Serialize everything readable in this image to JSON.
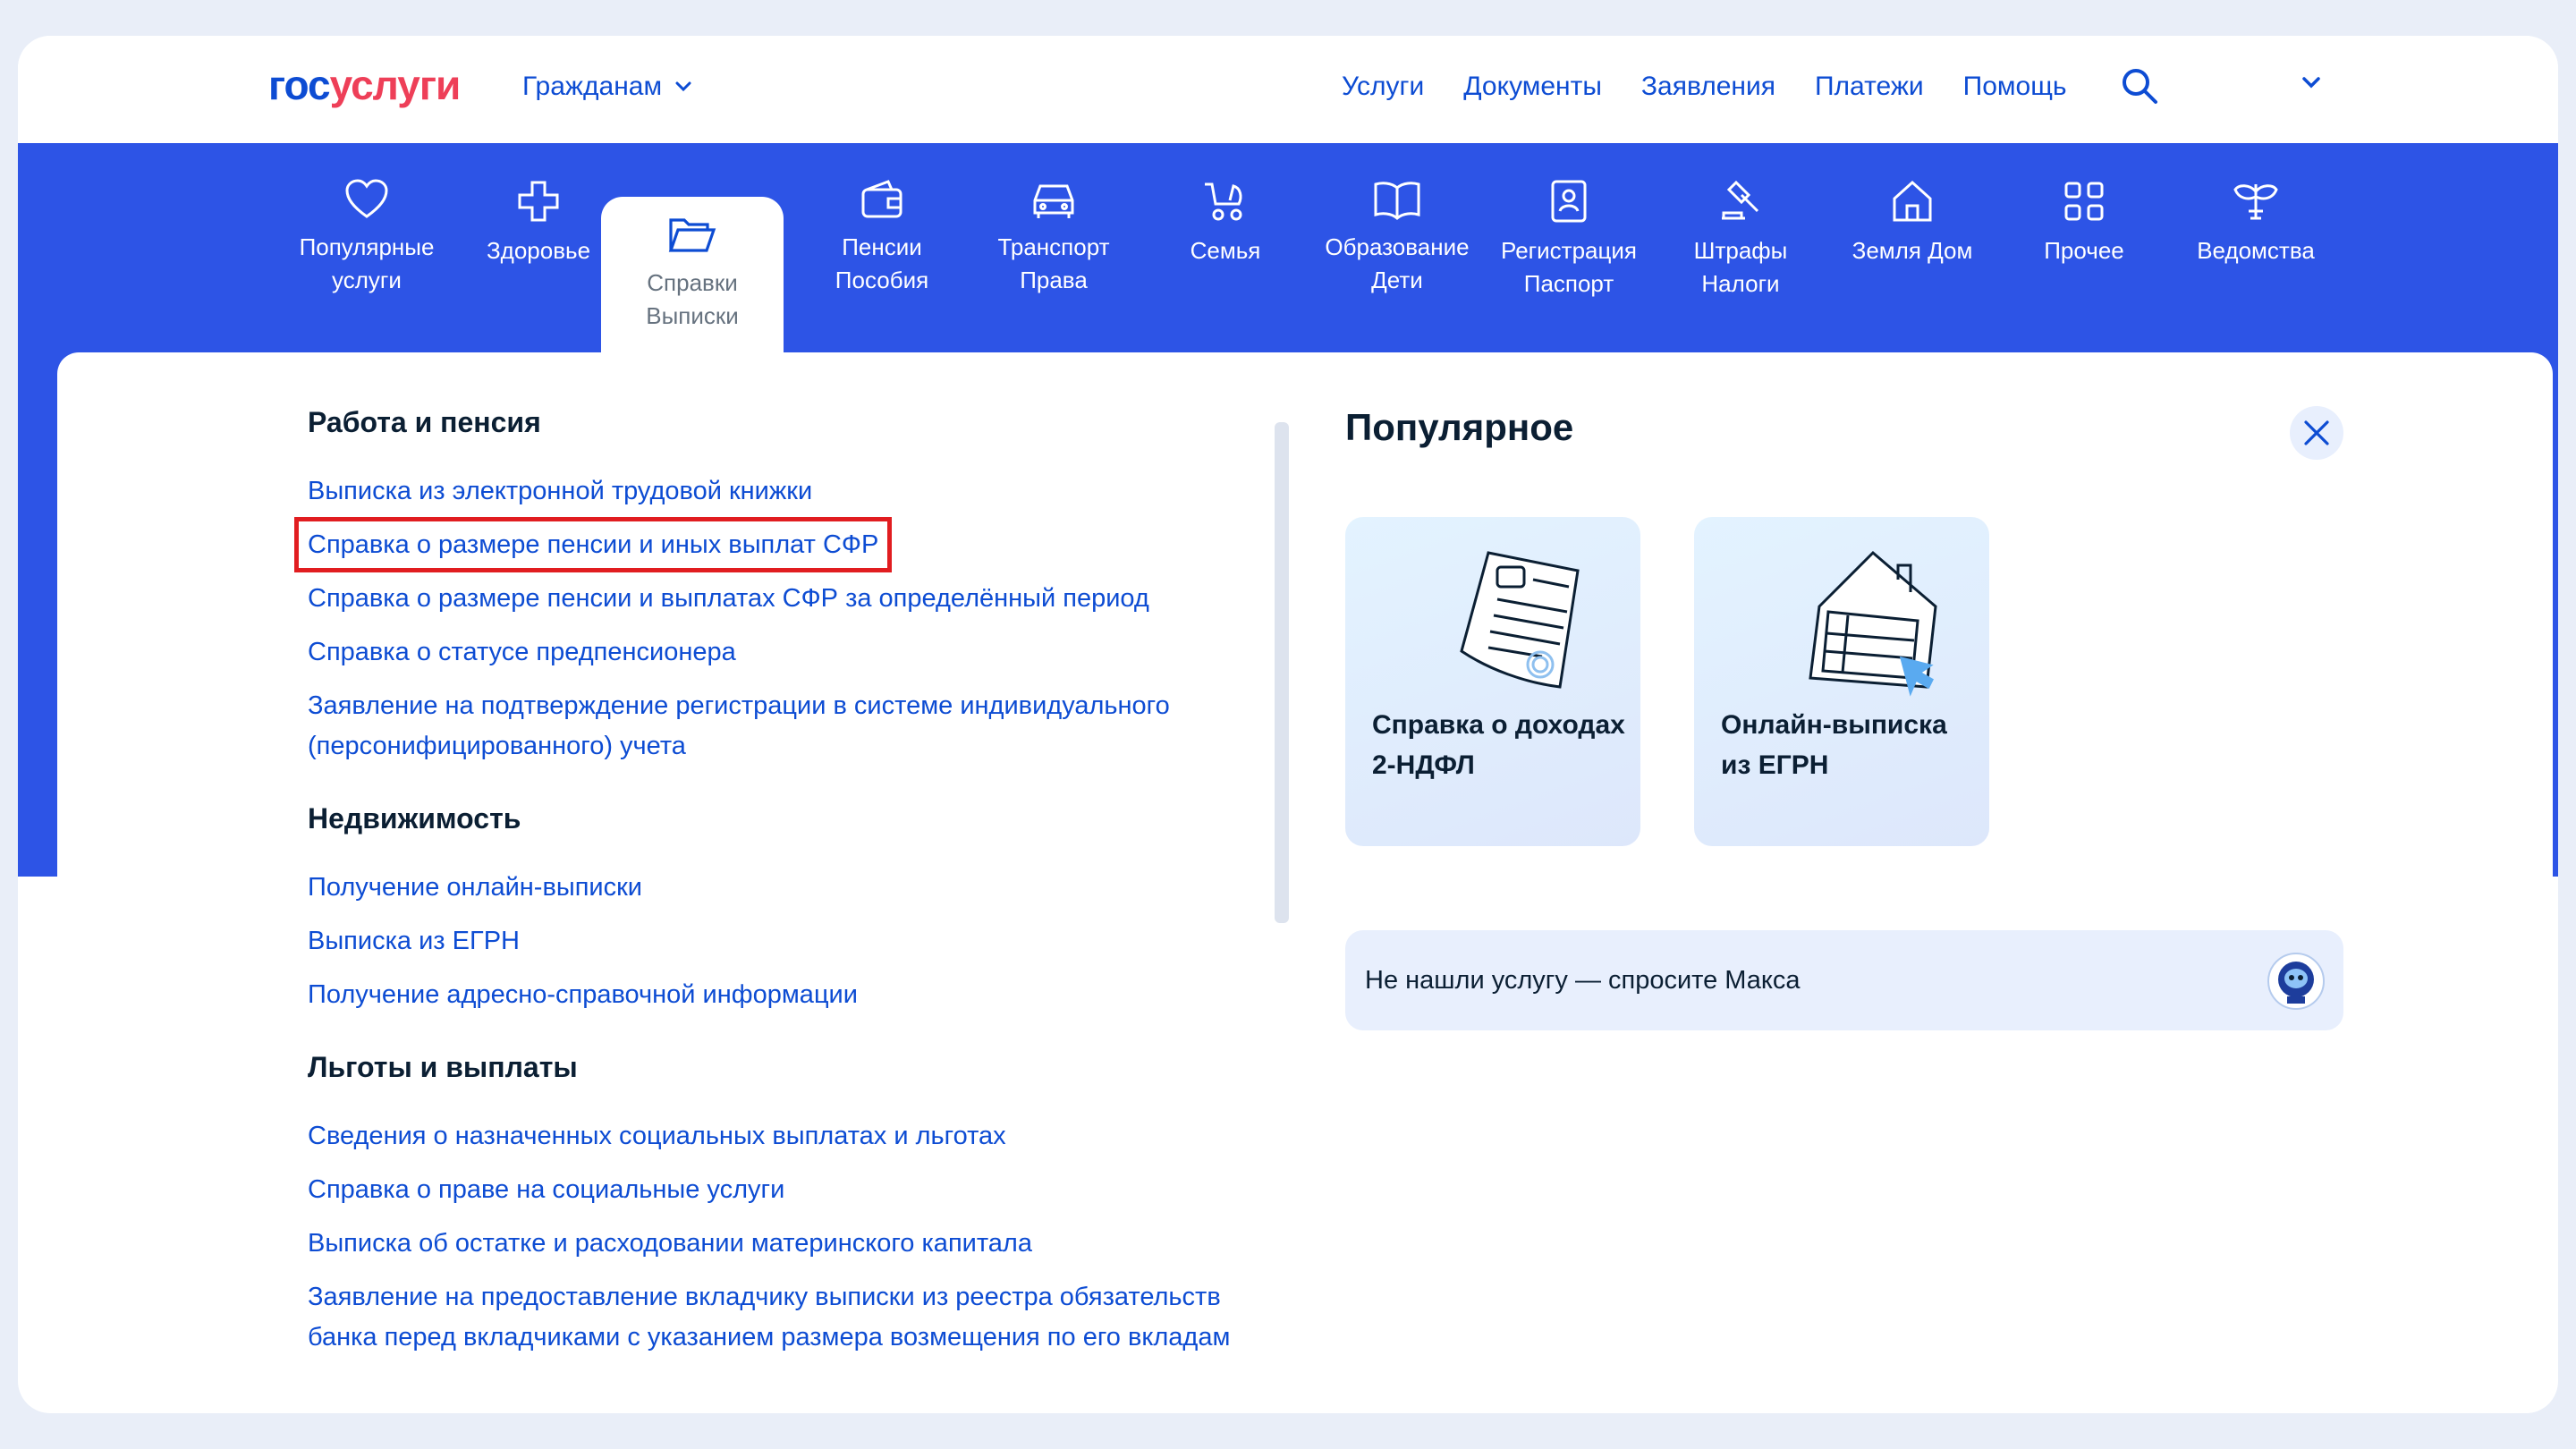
{
  "colors": {
    "brand": "#0d4cd3",
    "brand_red": "#ee3f58",
    "category_bar": "#2d54e6",
    "highlight": "#e11d20"
  },
  "header": {
    "logo_part1": "гос",
    "logo_part2": "услуги",
    "role": "Гражданам",
    "nav": [
      "Услуги",
      "Документы",
      "Заявления",
      "Платежи",
      "Помощь"
    ]
  },
  "categories": [
    {
      "label": "Популярные\nуслуги",
      "icon": "heart-icon"
    },
    {
      "label": "Здоровье",
      "icon": "cross-icon"
    },
    {
      "label": "Справки\nВыписки",
      "icon": "folder-icon",
      "active": true
    },
    {
      "label": "Пенсии\nПособия",
      "icon": "wallet-icon"
    },
    {
      "label": "Транспорт\nПрава",
      "icon": "car-icon"
    },
    {
      "label": "Семья",
      "icon": "stroller-icon"
    },
    {
      "label": "Образование\nДети",
      "icon": "book-icon"
    },
    {
      "label": "Регистрация\nПаспорт",
      "icon": "id-card-icon"
    },
    {
      "label": "Штрафы\nНалоги",
      "icon": "gavel-icon"
    },
    {
      "label": "Земля Дом",
      "icon": "house-icon"
    },
    {
      "label": "Прочее",
      "icon": "grid-icon"
    },
    {
      "label": "Ведомства",
      "icon": "emblem-icon"
    }
  ],
  "sections": [
    {
      "title": "Работа и пенсия",
      "links": [
        "Выписка из электронной трудовой книжки",
        "Справка о размере пенсии и иных выплат СФР",
        "Справка о размере пенсии и выплатах СФР за определённый период",
        "Справка о статусе предпенсионера",
        "Заявление на подтверждение регистрации в системе индивидуального (персонифицированного) учета"
      ]
    },
    {
      "title": "Недвижимость",
      "links": [
        "Получение онлайн-выписки",
        "Выписка из ЕГРН",
        "Получение адресно-справочной информации"
      ]
    },
    {
      "title": "Льготы и выплаты",
      "links": [
        "Сведения о назначенных социальных выплатах и льготах",
        "Справка о праве на социальные услуги",
        "Выписка об остатке и расходовании материнского капитала",
        "Заявление на предоставление вкладчику выписки из реестра обязательств банка перед вкладчиками с указанием размера возмещения по его вкладам"
      ]
    }
  ],
  "highlighted_link": "Справка о размере пенсии и иных выплат СФР",
  "popular": {
    "title": "Популярное",
    "tiles": [
      {
        "label": "Справка о доходах 2-НДФЛ",
        "icon": "document-seal-icon"
      },
      {
        "label": "Онлайн-выписка из ЕГРН",
        "icon": "house-document-icon"
      }
    ],
    "ask": "Не нашли услугу — спросите Макса"
  }
}
